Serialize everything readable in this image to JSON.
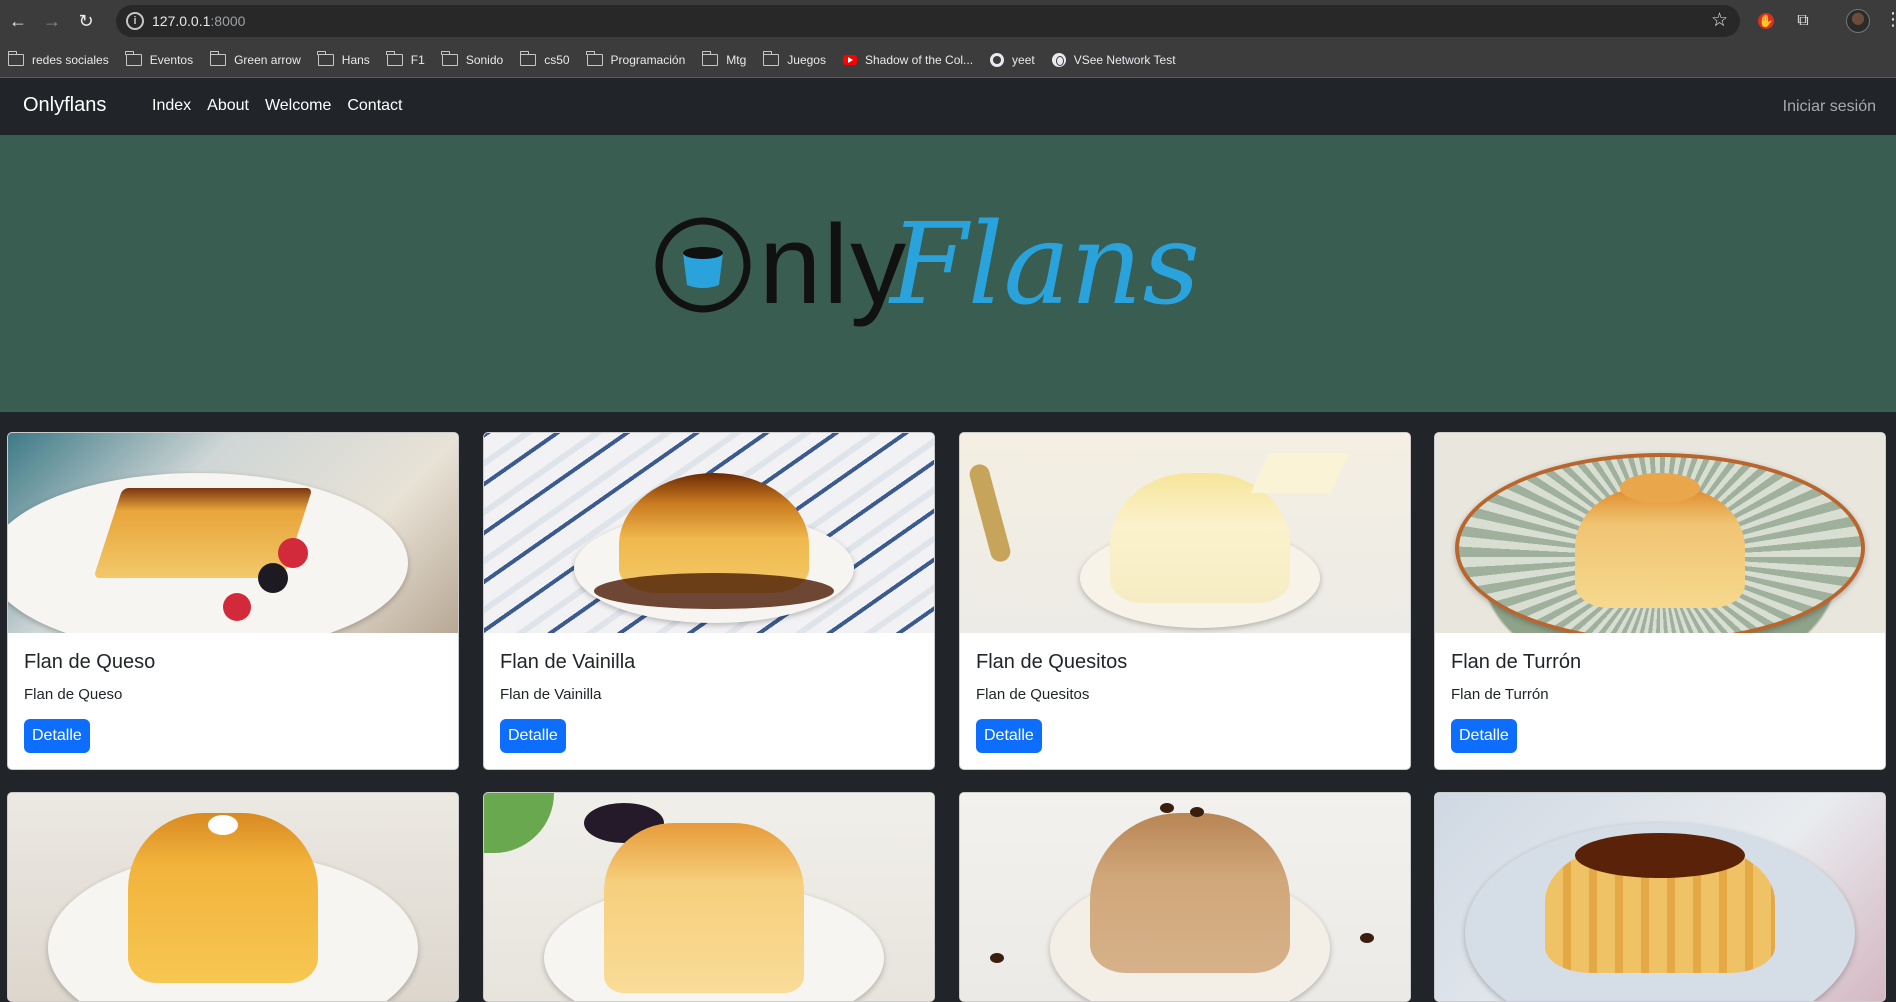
{
  "browser": {
    "url_host": "127.0.0.1",
    "url_port": ":8000",
    "bookmarks": [
      {
        "label": "redes sociales",
        "icon": "folder-icon"
      },
      {
        "label": "Eventos",
        "icon": "folder-icon"
      },
      {
        "label": "Green arrow",
        "icon": "folder-icon"
      },
      {
        "label": "Hans",
        "icon": "folder-icon"
      },
      {
        "label": "F1",
        "icon": "folder-icon"
      },
      {
        "label": "Sonido",
        "icon": "folder-icon"
      },
      {
        "label": "cs50",
        "icon": "folder-icon"
      },
      {
        "label": "Programación",
        "icon": "folder-icon"
      },
      {
        "label": "Mtg",
        "icon": "folder-icon"
      },
      {
        "label": "Juegos",
        "icon": "folder-icon"
      },
      {
        "label": "Shadow of the Col...",
        "icon": "youtube-icon"
      },
      {
        "label": "yeet",
        "icon": "github-icon"
      },
      {
        "label": "VSee Network Test",
        "icon": "globe-icon"
      }
    ]
  },
  "navbar": {
    "brand": "Onlyflans",
    "links": [
      "Index",
      "About",
      "Welcome",
      "Contact"
    ],
    "login": "Iniciar sesión"
  },
  "hero": {
    "logo_only": "Only",
    "logo_flans": "Flans",
    "background": "#3a5d52"
  },
  "cards": [
    {
      "title": "Flan de Queso",
      "text": "Flan de Queso",
      "button": "Detalle"
    },
    {
      "title": "Flan de Vainilla",
      "text": "Flan de Vainilla",
      "button": "Detalle"
    },
    {
      "title": "Flan de Quesitos",
      "text": "Flan de Quesitos",
      "button": "Detalle"
    },
    {
      "title": "Flan de Turrón",
      "text": "Flan de Turrón",
      "button": "Detalle"
    }
  ],
  "colors": {
    "accent": "#0d6efd",
    "navbar": "#212529",
    "logo_blue": "#2aa3dc"
  }
}
